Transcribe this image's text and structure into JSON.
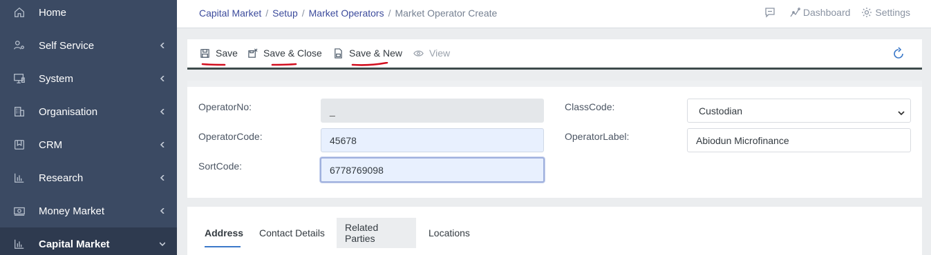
{
  "sidebar": {
    "items": [
      {
        "label": "Home",
        "icon": "home-icon",
        "has_chevron": false
      },
      {
        "label": "Self Service",
        "icon": "user-gear-icon",
        "has_chevron": true
      },
      {
        "label": "System",
        "icon": "monitor-icon",
        "has_chevron": true
      },
      {
        "label": "Organisation",
        "icon": "building-icon",
        "has_chevron": true
      },
      {
        "label": "CRM",
        "icon": "crm-icon",
        "has_chevron": true
      },
      {
        "label": "Research",
        "icon": "bar-chart-icon",
        "has_chevron": true
      },
      {
        "label": "Money Market",
        "icon": "money-icon",
        "has_chevron": true
      },
      {
        "label": "Capital Market",
        "icon": "bar-chart-icon",
        "has_chevron": true,
        "expanded": true
      }
    ]
  },
  "header": {
    "breadcrumb": [
      "Capital Market",
      "Setup",
      "Market Operators"
    ],
    "separator": "/",
    "current": "Market Operator Create",
    "dashboard_label": "Dashboard",
    "settings_label": "Settings"
  },
  "toolbar": {
    "save_label": "Save",
    "save_close_label": "Save & Close",
    "save_new_label": "Save & New",
    "view_label": "View"
  },
  "form": {
    "operator_no_label": "OperatorNo:",
    "operator_no_value": "_",
    "operator_code_label": "OperatorCode:",
    "operator_code_value": "45678",
    "sort_code_label": "SortCode:",
    "sort_code_value": "6778769098",
    "class_code_label": "ClassCode:",
    "class_code_value": "Custodian",
    "operator_label_label": "OperatorLabel:",
    "operator_label_value": "Abiodun Microfinance"
  },
  "tabs": [
    "Address",
    "Contact Details",
    "Related Parties",
    "Locations"
  ],
  "colors": {
    "sidebar_bg": "#3b4a63",
    "sidebar_active": "#2e3a4f",
    "link": "#3c4b9c",
    "annotation": "#d10f1f",
    "accent": "#3a78c9"
  }
}
